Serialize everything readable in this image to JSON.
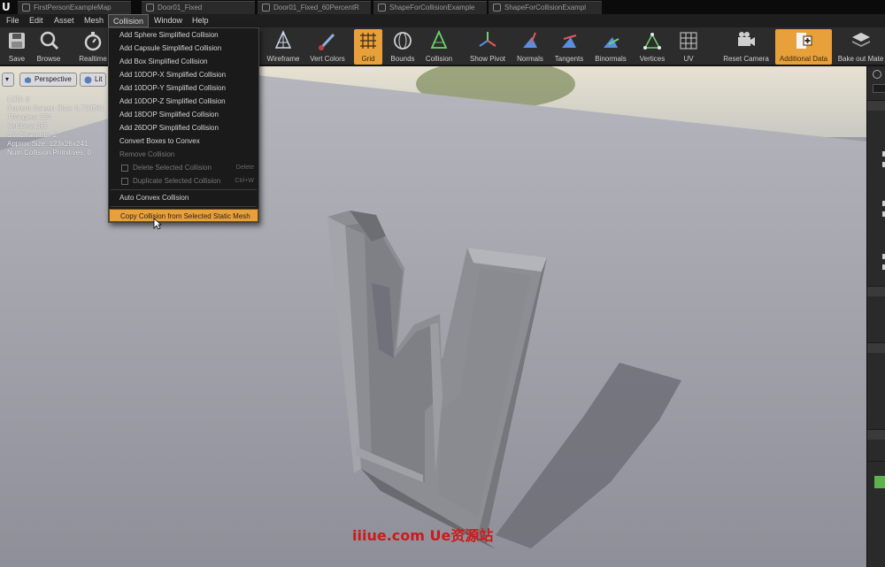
{
  "tabs": [
    {
      "label": "FirstPersonExampleMap"
    },
    {
      "label": "Door01_Fixed"
    },
    {
      "label": "Door01_Fixed_60PercentR"
    },
    {
      "label": "ShapeForCollisionExample"
    },
    {
      "label": "ShapeForCollisionExampl"
    }
  ],
  "menubar": {
    "items": [
      "File",
      "Edit",
      "Asset",
      "Mesh",
      "Collision",
      "Window",
      "Help"
    ],
    "active": "Collision"
  },
  "toolbar": {
    "save": "Save",
    "browse": "Browse",
    "realtime": "Realtime",
    "wireframe": "Wireframe",
    "vert_colors": "Vert Colors",
    "grid": "Grid",
    "bounds": "Bounds",
    "collision": "Collision",
    "show_pivot": "Show Pivot",
    "normals": "Normals",
    "tangents": "Tangents",
    "binormals": "Binormals",
    "vertices": "Vertices",
    "uv": "UV",
    "reset_camera": "Reset Camera",
    "additional_data": "Additional Data",
    "bake_out": "Bake out Mate"
  },
  "collision_menu": {
    "items": [
      "Add Sphere Simplified Collision",
      "Add Capsule Simplified Collision",
      "Add Box Simplified Collision",
      "Add 10DOP-X Simplified Collision",
      "Add 10DOP-Y Simplified Collision",
      "Add 10DOP-Z Simplified Collision",
      "Add 18DOP Simplified Collision",
      "Add 26DOP Simplified Collision",
      "Convert Boxes to Convex"
    ],
    "remove": "Remove Collision",
    "delete_selected": "Delete Selected Collision",
    "delete_shortcut": "Delete",
    "duplicate_selected": "Duplicate Selected Collision",
    "duplicate_shortcut": "Ctrl+W",
    "auto_convex": "Auto Convex Collision",
    "copy_from_selected": "Copy Collision from Selected Static Mesh"
  },
  "viewport": {
    "perspective": "Perspective",
    "lit": "Lit",
    "stats": [
      "LOD:  0",
      "Current Screen Size:  0.720561",
      "Triangles:  234",
      "Vertices:  367",
      "UV Channels:  2",
      "Approx Size: 123x26x241",
      "Num Collision Primitives:  0"
    ]
  },
  "watermark": "iiiue.com  Ue资源站",
  "colors": {
    "accent": "#e8a13a",
    "menu_bg": "#1a1a1a",
    "toolbar_bg": "#2c2c2c",
    "floor": "#9a9ba4",
    "mesh": "#8f9095"
  }
}
